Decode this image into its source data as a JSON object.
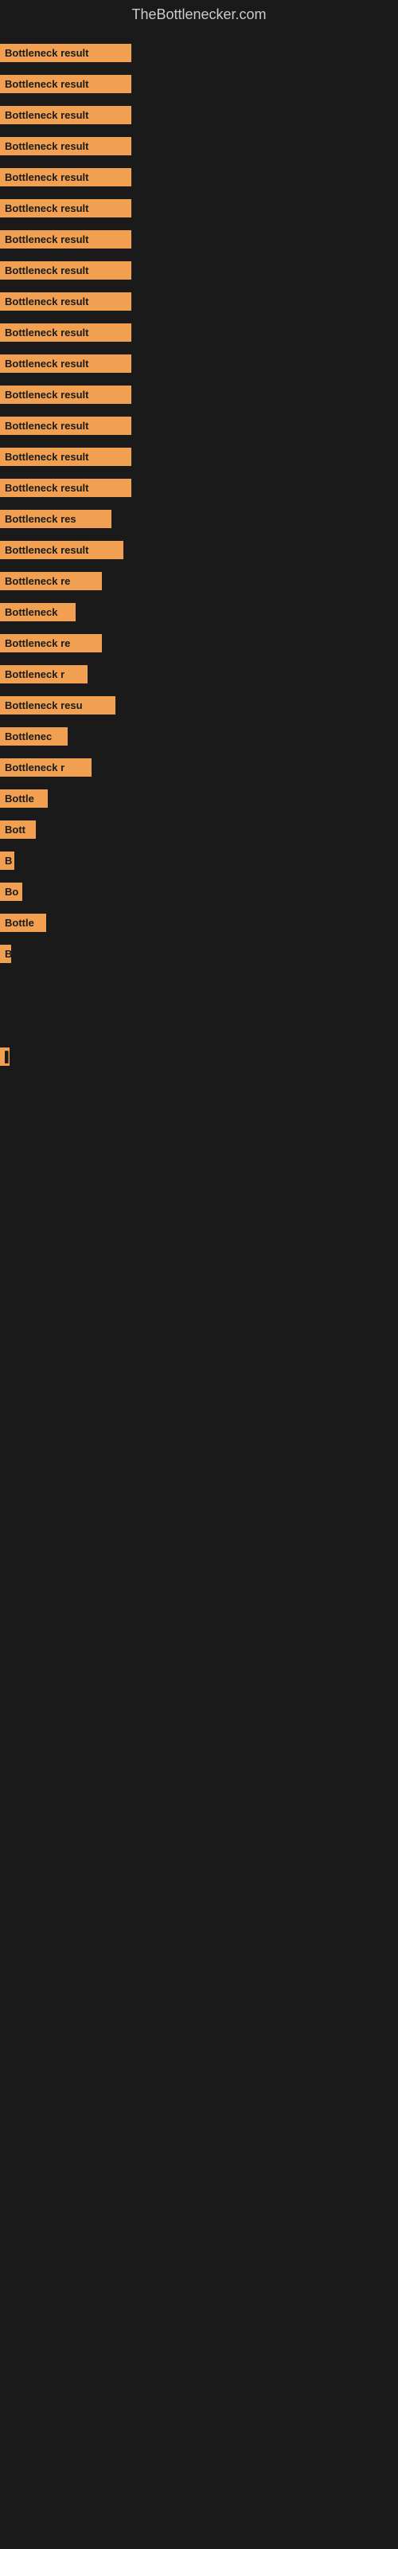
{
  "site": {
    "title": "TheBottlenecker.com"
  },
  "bars": [
    {
      "label": "Bottleneck result",
      "width": 165
    },
    {
      "label": "Bottleneck result",
      "width": 165
    },
    {
      "label": "Bottleneck result",
      "width": 165
    },
    {
      "label": "Bottleneck result",
      "width": 165
    },
    {
      "label": "Bottleneck result",
      "width": 165
    },
    {
      "label": "Bottleneck result",
      "width": 165
    },
    {
      "label": "Bottleneck result",
      "width": 165
    },
    {
      "label": "Bottleneck result",
      "width": 165
    },
    {
      "label": "Bottleneck result",
      "width": 165
    },
    {
      "label": "Bottleneck result",
      "width": 165
    },
    {
      "label": "Bottleneck result",
      "width": 165
    },
    {
      "label": "Bottleneck result",
      "width": 165
    },
    {
      "label": "Bottleneck result",
      "width": 165
    },
    {
      "label": "Bottleneck result",
      "width": 165
    },
    {
      "label": "Bottleneck result",
      "width": 165
    },
    {
      "label": "Bottleneck res",
      "width": 140
    },
    {
      "label": "Bottleneck result",
      "width": 155
    },
    {
      "label": "Bottleneck re",
      "width": 128
    },
    {
      "label": "Bottleneck",
      "width": 95
    },
    {
      "label": "Bottleneck re",
      "width": 128
    },
    {
      "label": "Bottleneck r",
      "width": 110
    },
    {
      "label": "Bottleneck resu",
      "width": 145
    },
    {
      "label": "Bottlenec",
      "width": 85
    },
    {
      "label": "Bottleneck r",
      "width": 115
    },
    {
      "label": "Bottle",
      "width": 60
    },
    {
      "label": "Bott",
      "width": 45
    },
    {
      "label": "B",
      "width": 18
    },
    {
      "label": "Bo",
      "width": 28
    },
    {
      "label": "Bottle",
      "width": 58
    },
    {
      "label": "B",
      "width": 14
    },
    {
      "label": "",
      "width": 0
    },
    {
      "label": "",
      "width": 0
    },
    {
      "label": "",
      "width": 0
    },
    {
      "label": "▌",
      "width": 10
    },
    {
      "label": "",
      "width": 0
    },
    {
      "label": "",
      "width": 0
    },
    {
      "label": "",
      "width": 0
    }
  ]
}
